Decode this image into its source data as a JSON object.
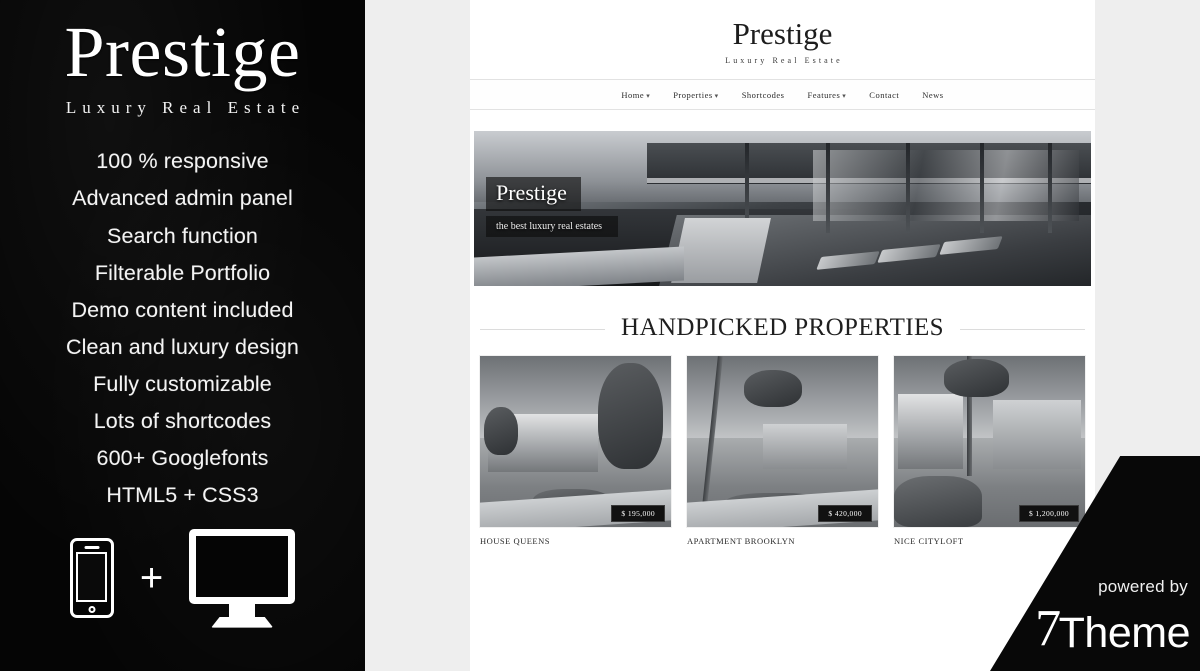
{
  "promo": {
    "logo": "Prestige",
    "tagline": "Luxury Real Estate",
    "features": [
      "100 % responsive",
      "Advanced admin panel",
      "Search function",
      "Filterable Portfolio",
      "Demo content included",
      "Clean and luxury design",
      "Fully customizable",
      "Lots of shortcodes",
      "600+ Googlefonts",
      "HTML5 + CSS3"
    ],
    "devices": {
      "phone_icon": "mobile-phone-icon",
      "plus": "+",
      "monitor_icon": "desktop-monitor-icon"
    },
    "background_color": "#050505",
    "text_color": "#f4f4f4"
  },
  "site": {
    "logo": "Prestige",
    "tagline": "Luxury Real Estate",
    "nav": [
      {
        "label": "Home",
        "has_dropdown": true,
        "caret": "▾"
      },
      {
        "label": "Properties",
        "has_dropdown": true,
        "caret": "▾"
      },
      {
        "label": "Shortcodes",
        "has_dropdown": false,
        "caret": ""
      },
      {
        "label": "Features",
        "has_dropdown": true,
        "caret": "▾"
      },
      {
        "label": "Contact",
        "has_dropdown": false,
        "caret": ""
      },
      {
        "label": "News",
        "has_dropdown": false,
        "caret": ""
      }
    ],
    "hero": {
      "title": "Prestige",
      "subtitle": "the best luxury real estates",
      "image_alt": "luxury-villa-pool-photo"
    },
    "section": {
      "heading": "HANDPICKED PROPERTIES"
    },
    "properties": [
      {
        "title": "HOUSE QUEENS",
        "price": "$ 195,000",
        "image_alt": "house-exterior-photo"
      },
      {
        "title": "APARTMENT BROOKLYN",
        "price": "$ 420,000",
        "image_alt": "apartment-garden-photo"
      },
      {
        "title": "NICE CITYLOFT",
        "price": "$ 1,200,000",
        "image_alt": "cityloft-courtyard-photo"
      }
    ]
  },
  "corner": {
    "powered_by": "powered by",
    "brand_mark": "7",
    "brand_name": "Theme",
    "background_color": "#080808"
  }
}
